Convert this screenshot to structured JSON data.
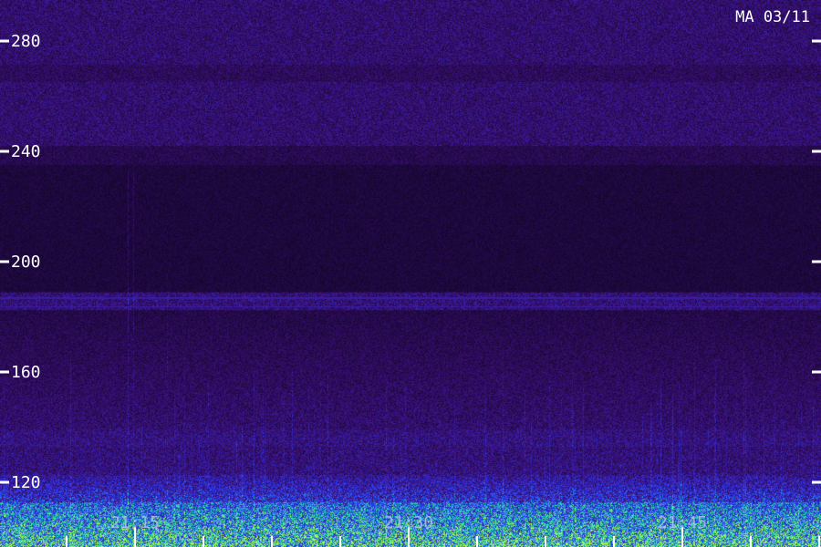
{
  "chart_data": {
    "type": "heatmap",
    "title": "MA 03/11",
    "y_ticks": [
      280,
      240,
      200,
      160,
      120
    ],
    "x_ticks": [
      "21:15",
      "21:30",
      "21:45"
    ],
    "colors": {
      "background": "#1a0630",
      "low": "#3b0f7a",
      "mid": "#2a3cff",
      "high": "#20e0a0",
      "peak": "#c8ff30",
      "tick": "#ffffff"
    }
  }
}
